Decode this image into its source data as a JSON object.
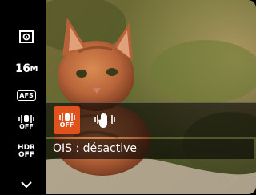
{
  "sidebar": {
    "items": [
      {
        "name": "metering-icon"
      },
      {
        "name": "image-size",
        "value": "16",
        "unit": "M"
      },
      {
        "name": "af-mode",
        "label": "AFS"
      },
      {
        "name": "ois-off-icon",
        "label": "OFF"
      },
      {
        "name": "hdr",
        "label_top": "HDR",
        "label_bottom": "OFF"
      },
      {
        "name": "chevron-down-icon"
      }
    ]
  },
  "submenu": {
    "options": [
      {
        "name": "ois-off-option",
        "label": "OFF",
        "selected": true
      },
      {
        "name": "ois-on-option",
        "label": "",
        "selected": false
      }
    ]
  },
  "status": {
    "text": "OIS : désactive"
  },
  "colors": {
    "accent": "#e0521d",
    "panel": "#000000"
  }
}
